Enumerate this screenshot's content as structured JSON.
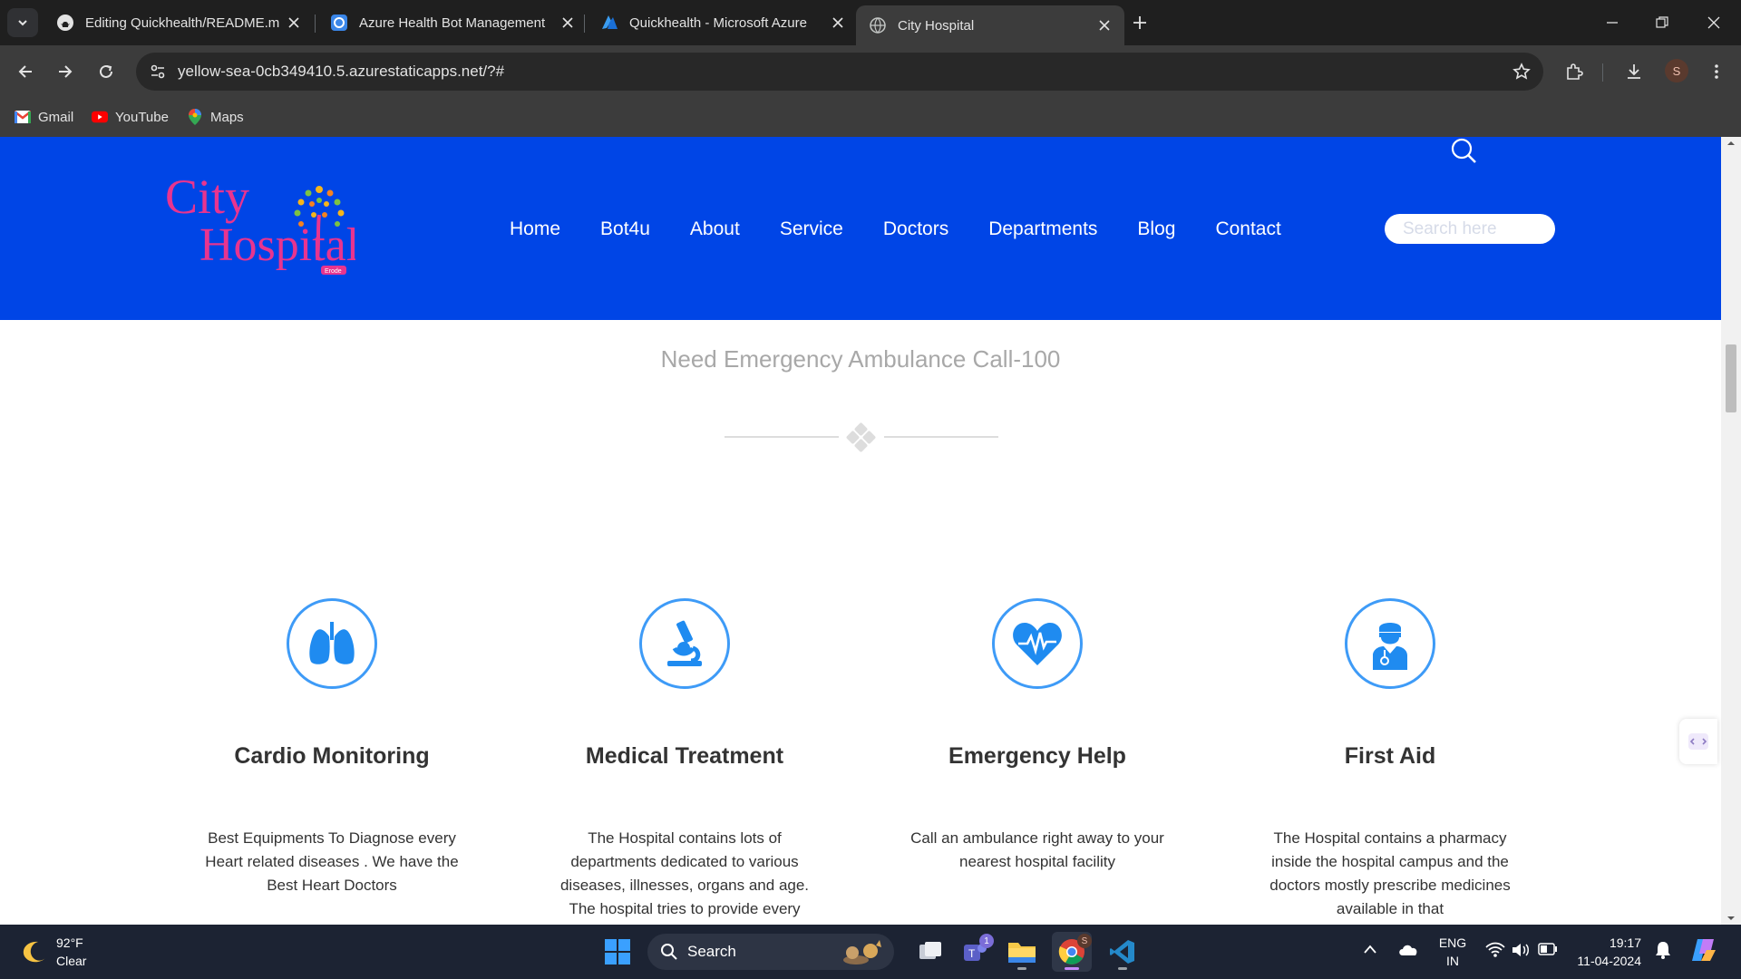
{
  "browser": {
    "tabs": [
      {
        "title": "Editing Quickhealth/README.m",
        "icon": "github-icon"
      },
      {
        "title": "Azure Health Bot Management",
        "icon": "health-bot-icon"
      },
      {
        "title": "Quickhealth - Microsoft Azure",
        "icon": "azure-icon"
      },
      {
        "title": "City Hospital",
        "icon": "globe-icon",
        "active": true
      }
    ],
    "url": "yellow-sea-0cb349410.5.azurestaticapps.net/?#",
    "profile_initial": "S",
    "bookmarks": [
      {
        "label": "Gmail",
        "icon": "gmail-icon"
      },
      {
        "label": "YouTube",
        "icon": "youtube-icon"
      },
      {
        "label": "Maps",
        "icon": "maps-icon"
      }
    ]
  },
  "site": {
    "logo": {
      "line1": "City",
      "line2": "Hospital",
      "sub": "Erode"
    },
    "nav": [
      "Home",
      "Bot4u",
      "About",
      "Service",
      "Doctors",
      "Departments",
      "Blog",
      "Contact"
    ],
    "search_placeholder": "Search here",
    "emergency_text": "Need Emergency Ambulance Call-100",
    "features": [
      {
        "title": "Cardio Monitoring",
        "icon": "lungs-icon",
        "desc": "Best Equipments To Diagnose every Heart related diseases . We have the Best Heart Doctors"
      },
      {
        "title": "Medical Treatment",
        "icon": "microscope-icon",
        "desc": "The Hospital contains lots of departments dedicated to various diseases, illnesses, organs and age. The hospital tries to provide every"
      },
      {
        "title": "Emergency Help",
        "icon": "heart-pulse-icon",
        "desc": "Call an ambulance right away to your nearest hospital facility"
      },
      {
        "title": "First Aid",
        "icon": "doctor-icon",
        "desc": "The Hospital contains a pharmacy inside the hospital campus and the doctors mostly prescribe medicines available in that"
      }
    ]
  },
  "taskbar": {
    "weather_temp": "92°F",
    "weather_desc": "Clear",
    "search_label": "Search",
    "teams_badge": "1",
    "lang_line1": "ENG",
    "lang_line2": "IN",
    "time": "19:17",
    "date": "11-04-2024"
  },
  "colors": {
    "header_blue": "#0045e6",
    "icon_blue": "#1f8bf0",
    "logo_pink": "#e8348f"
  }
}
